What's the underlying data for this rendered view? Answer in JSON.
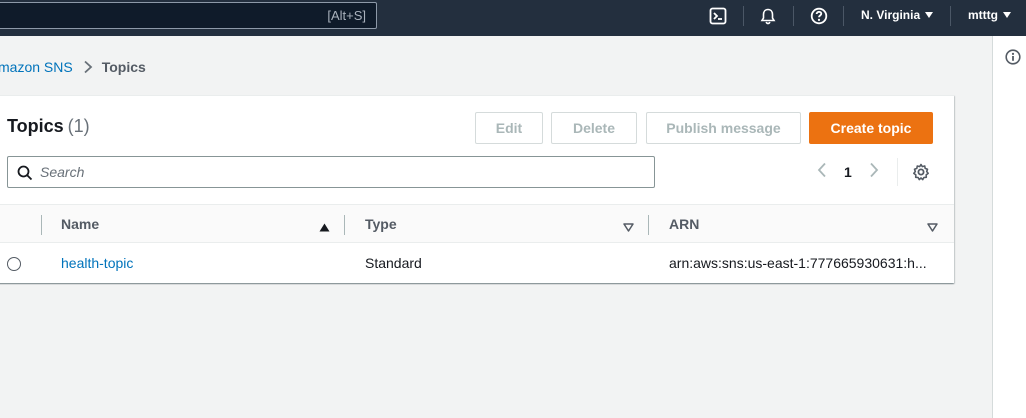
{
  "topbar": {
    "search_hint": "[Alt+S]",
    "region": "N. Virginia",
    "user": "mtttg",
    "icons": [
      "cloudshell-icon",
      "bell-icon",
      "help-icon"
    ]
  },
  "breadcrumb": {
    "parent": "mazon SNS",
    "current": "Topics"
  },
  "topics": {
    "title": "Topics",
    "count": "(1)",
    "buttons": {
      "edit": "Edit",
      "delete": "Delete",
      "publish": "Publish message",
      "create": "Create topic"
    },
    "search_placeholder": "Search",
    "page": "1",
    "columns": {
      "name": "Name",
      "type": "Type",
      "arn": "ARN"
    },
    "rows": [
      {
        "name": "health-topic",
        "type": "Standard",
        "arn": "arn:aws:sns:us-east-1:777665930631:h..."
      }
    ]
  },
  "colors": {
    "nav_bg": "#232f3e",
    "primary": "#ec7211",
    "link": "#0073bb"
  }
}
